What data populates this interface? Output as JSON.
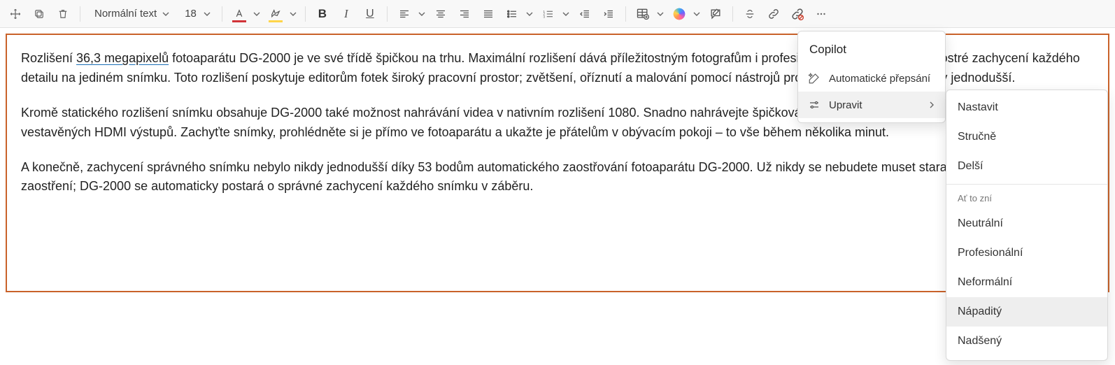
{
  "toolbar": {
    "style_label": "Normální text",
    "font_size": "18"
  },
  "document": {
    "p1_pre": "Rozlišení ",
    "p1_link": "36,3 megapixelů",
    "p1_post": " fotoaparátu DG-2000 je ve své třídě špičkou na trhu. Maximální rozlišení dává příležitostným fotografům i profesionálům velký prostor pro ostré zachycení každého detailu na jediném snímku. Toto rozlišení poskytuje editorům fotek široký pracovní prostor; zvětšení, oříznutí a malování pomocí nástrojů pro úpravy fotek nebylo nikdy jednodušší.",
    "p2": "Kromě statického rozlišení snímku obsahuje DG-2000 také možnost nahrávání videa v nativním rozlišení 1080. Snadno nahrávejte špičková HD videa a prohlížejte je a nahrávejte pomocí vestavěných HDMI výstupů. Zachyťte snímky, prohlédněte si je přímo ve fotoaparátu a ukažte je přátelům v obývacím pokoji – to vše během několika minut.",
    "p3": "A konečně, zachycení správného snímku nebylo nikdy jednodušší díky 53 bodům automatického zaostřování fotoaparátu DG-2000. Už nikdy se nebudete muset starat o dokonalé nastavení zaostření; DG-2000 se automaticky postará o správné zachycení každého snímku v záběru."
  },
  "copilot_menu": {
    "title": "Copilot",
    "rewrite": "Automatické přepsání",
    "modify": "Upravit"
  },
  "tone_menu": {
    "set": "Nastavit",
    "short": "Stručně",
    "longer": "Delší",
    "sound_header": "Ať to zní",
    "neutral": "Neutrální",
    "professional": "Profesionální",
    "informal": "Neformální",
    "creative": "Nápaditý",
    "enthusiastic": "Nadšený"
  }
}
